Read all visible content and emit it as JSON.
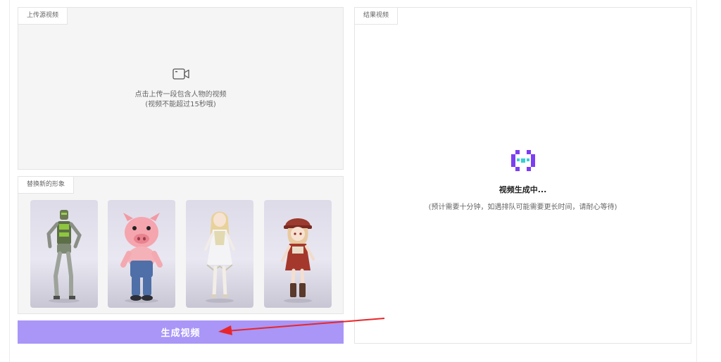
{
  "upload": {
    "tag": "上传源视频",
    "prompt": "点击上传一段包含人物的视频",
    "hint": "(视频不能超过15秒哦)"
  },
  "avatars": {
    "tag": "替换新的形象",
    "items": [
      {
        "icon": "robot-avatar-icon"
      },
      {
        "icon": "pig-avatar-icon"
      },
      {
        "icon": "blonde-girl-avatar-icon"
      },
      {
        "icon": "red-hat-girl-avatar-icon"
      }
    ]
  },
  "generate": {
    "label": "生成视频"
  },
  "result": {
    "tag": "结果视频",
    "status_title": "视频生成中...",
    "status_note": "(预计需要十分钟，如遇排队可能需要更长时间，请耐心等待)"
  },
  "colors": {
    "accent": "#a996f7",
    "loader_purple": "#7b3ff2",
    "loader_cyan": "#35d0d6",
    "arrow_red": "#e8262a"
  }
}
